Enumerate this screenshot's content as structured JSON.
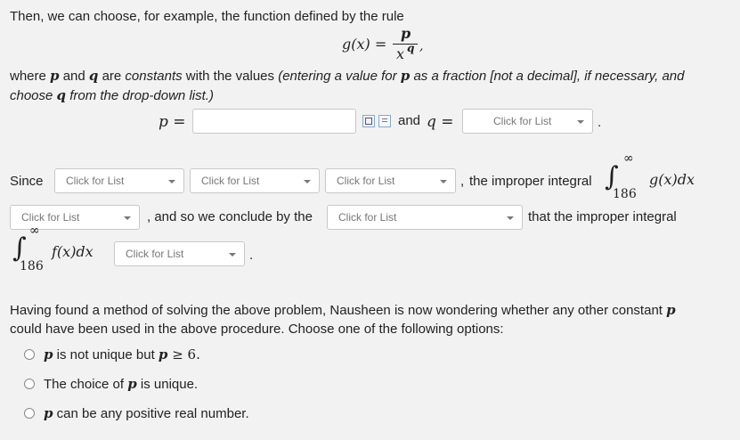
{
  "intro": {
    "line1": "Then, we can choose, for example, the function defined by the rule",
    "g_lhs": "g(x) =",
    "frac_num": "p",
    "frac_den": "x",
    "frac_den_exp": "q",
    "frac_comma": ","
  },
  "where": {
    "w1": "where ",
    "p": "p",
    "w2": " and ",
    "q": "q",
    "w3": " are ",
    "constants": "constants",
    "w4": " with the values ",
    "paren1": "(entering a value for ",
    "p2": "p",
    "paren2": " as a fraction [not a decimal], if necessary, and",
    "line2a": "choose ",
    "q2": "q",
    "line2b": " from the drop-down list.)"
  },
  "pq_row": {
    "p_label": "p =",
    "p_value": "",
    "and_text": "and",
    "q_label": "q =",
    "q_select": "Click for List",
    "period": "."
  },
  "since_row": {
    "since": "Since",
    "sel1": "Click for List",
    "sel2": "Click for List",
    "sel3": "Click for List",
    "comma": ",",
    "improper": "the improper integral",
    "int_upper": "∞",
    "int_lower": "186",
    "integrand": "g(x)dx"
  },
  "conclude_row": {
    "sel4": "Click for List",
    "text": ", and so we conclude by the",
    "sel5": "Click for List",
    "text2": "that the improper integral"
  },
  "final_row": {
    "int_upper": "∞",
    "int_lower": "186",
    "integrand": "f(x)dx",
    "sel6": "Click for List",
    "period": "."
  },
  "question": {
    "line1a": "Having found a method of solving the above problem, Nausheen is now wondering whether any other constant ",
    "p": "p",
    "line2": "could have been used in the above procedure. Choose one of the following options:"
  },
  "options": [
    {
      "pre": "",
      "var": "p",
      "text": " is not unique but ",
      "var2": "p",
      "rel": " ≥ ",
      "num": "6",
      "end": "."
    },
    {
      "pre": "The choice of ",
      "var": "p",
      "text": " is unique.",
      "var2": "",
      "rel": "",
      "num": "",
      "end": ""
    },
    {
      "pre": "",
      "var": "p",
      "text": " can be any positive real number.",
      "var2": "",
      "rel": "",
      "num": "",
      "end": ""
    }
  ],
  "icons": {
    "equation_editor": "equation-editor-icon",
    "preview": "preview-icon"
  }
}
